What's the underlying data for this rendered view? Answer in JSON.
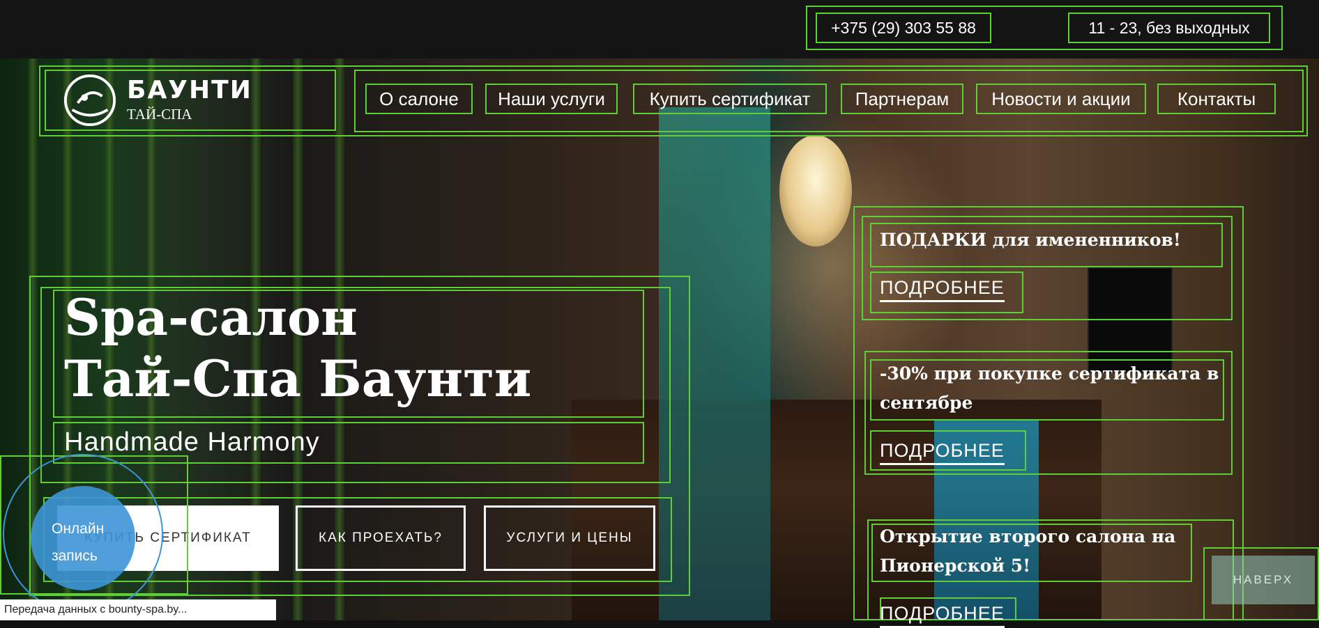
{
  "topbar": {
    "phone": "+375 (29) 303 55 88",
    "hours": "11 - 23, без выходных"
  },
  "logo": {
    "name": "БАУНТИ",
    "subtitle": "ТАЙ-СПА"
  },
  "nav": {
    "items": [
      {
        "label": "О салоне"
      },
      {
        "label": "Наши услуги"
      },
      {
        "label": "Купить сертификат"
      },
      {
        "label": "Партнерам"
      },
      {
        "label": "Новости и акции"
      },
      {
        "label": "Контакты"
      }
    ]
  },
  "hero": {
    "title_line1": "Spa-салон",
    "title_line2": "Тай-Спа Баунти",
    "tagline": "Handmade Harmony",
    "buttons": {
      "buy_certificate": "КУПИТЬ СЕРТИФИКАТ",
      "directions": "КАК ПРОЕХАТЬ?",
      "services": "УСЛУГИ И ЦЕНЫ"
    }
  },
  "online_booking": {
    "line1": "Онлайн",
    "line2": "запись"
  },
  "news": {
    "items": [
      {
        "title": "ПОДАРКИ для имененников!",
        "more": "ПОДРОБНЕЕ"
      },
      {
        "title": "-30% при покупке сертификата в сентябре",
        "more": "ПОДРОБНЕЕ"
      },
      {
        "title": "Открытие второго салона на Пионерской 5!",
        "more": "ПОДРОБНЕЕ"
      }
    ]
  },
  "back_to_top": "НАВЕРХ",
  "status_bar": "Передача данных с bounty-spa.by...",
  "colors": {
    "outline": "#5fcf37",
    "topbar": "#141414",
    "online_button": "#3d95d6"
  }
}
